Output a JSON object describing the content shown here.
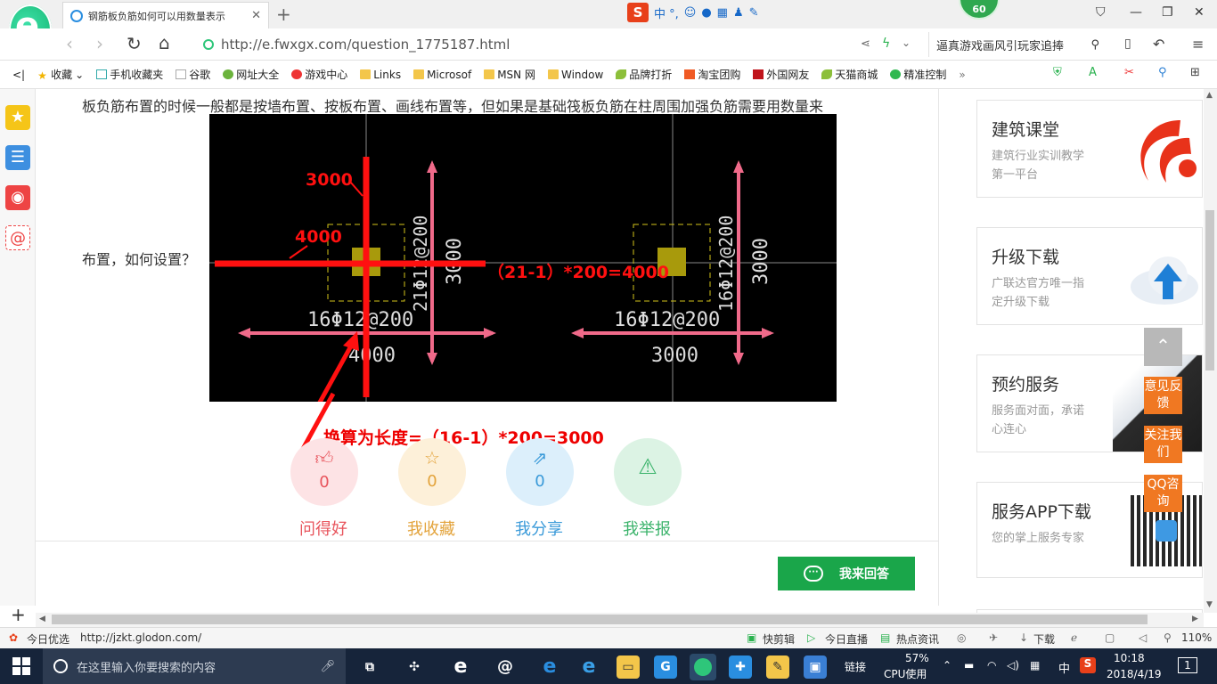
{
  "browser": {
    "tab_title": "钢筋板负筋如何可以用数量表示",
    "ime_label": "中 °,",
    "badge_count": "60",
    "url": "http://e.fwxgx.com/question_1775187.html",
    "search_text": "逼真游戏画风引玩家追捧"
  },
  "bookmarks": [
    {
      "label": "收藏",
      "icon": "star-icon"
    },
    {
      "label": "手机收藏夹",
      "icon": "phone-icon"
    },
    {
      "label": "谷歌",
      "icon": "page-icon"
    },
    {
      "label": "网址大全",
      "icon": "globe-icon"
    },
    {
      "label": "游戏中心",
      "icon": "game-icon"
    },
    {
      "label": "Links",
      "icon": "folder-icon"
    },
    {
      "label": "Microsof",
      "icon": "folder-icon"
    },
    {
      "label": "MSN 网",
      "icon": "folder-icon"
    },
    {
      "label": "Window",
      "icon": "folder-icon"
    },
    {
      "label": "品牌打折",
      "icon": "leaf-icon"
    },
    {
      "label": "淘宝团购",
      "icon": "taobao-icon"
    },
    {
      "label": "外国网友",
      "icon": "bookmark-icon"
    },
    {
      "label": "天猫商城",
      "icon": "leaf-icon"
    },
    {
      "label": "精准控制",
      "icon": "wechat-icon"
    }
  ],
  "question": {
    "line1": "板负筋布置的时候一般都是按墙布置、按板布置、画线布置等，但如果是基础筏板负筋在柱周围加强负筋需要用数量来",
    "line2": "布置，如何设置？"
  },
  "cad": {
    "left_bottom_rebar": "16Φ12@200",
    "left_side_rebar": "21Φ12@200",
    "left_width": "4000",
    "left_height": "3000",
    "right_bottom_rebar": "16Φ12@200",
    "right_side_rebar": "16Φ12@200",
    "right_width": "3000",
    "right_height": "3000",
    "annot_3000": "3000",
    "annot_4000": "4000",
    "annot_formula": "（21-1）*200=4000"
  },
  "convert_text": "换算为长度=（16-1）*200=3000",
  "actions": [
    {
      "label": "问得好",
      "count": "0",
      "icon": "thumb-up-icon",
      "color": "#e8545c",
      "bg": "#fde3e5"
    },
    {
      "label": "我收藏",
      "count": "0",
      "icon": "star-outline-icon",
      "color": "#e3a33b",
      "bg": "#fdf0d9"
    },
    {
      "label": "我分享",
      "count": "0",
      "icon": "share-icon",
      "color": "#3a9ad9",
      "bg": "#dceffb"
    },
    {
      "label": "我举报",
      "count": "",
      "icon": "warning-icon",
      "color": "#3bb36b",
      "bg": "#dcf3e4"
    }
  ],
  "answer_label": "我来回答",
  "sidebar": [
    {
      "title": "建筑课堂",
      "desc": "建筑行业实训教学第一平台"
    },
    {
      "title": "升级下载",
      "desc": "广联达官方唯一指定升级下载"
    },
    {
      "title": "预约服务",
      "desc": "服务面对面，承诺心连心"
    },
    {
      "title": "服务APP下载",
      "desc": "您的掌上服务专家"
    }
  ],
  "float_buttons": [
    "意见反馈",
    "关注我们",
    "QQ咨询"
  ],
  "status": {
    "today": "今日优选",
    "link": "http://jzkt.glodon.com/",
    "kuaijianji": "快剪辑",
    "live": "今日直播",
    "news": "热点资讯",
    "download": "下载",
    "zoom": "110%"
  },
  "taskbar": {
    "search_placeholder": "在这里输入你要搜索的内容",
    "link_label": "链接",
    "cpu_percent": "57%",
    "cpu_label": "CPU使用",
    "ime": "中",
    "time": "10:18",
    "date": "2018/4/19",
    "notif": "1"
  }
}
